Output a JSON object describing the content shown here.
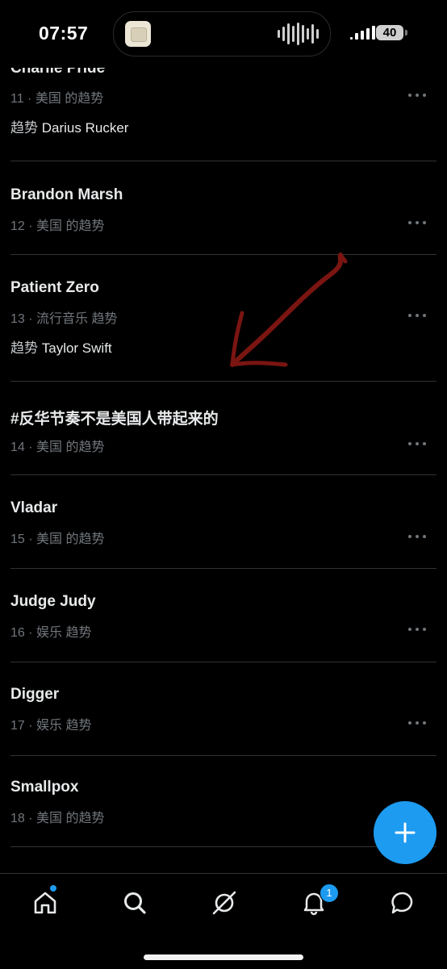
{
  "status_bar": {
    "time": "07:57",
    "battery": "40"
  },
  "trends": [
    {
      "title": "Charlie Pride",
      "meta": "11 · 美国 的趋势",
      "sub_prefix": "趋势 ",
      "sub_name": "Darius Rucker"
    },
    {
      "title": "Brandon Marsh",
      "meta": "12 · 美国 的趋势"
    },
    {
      "title": "Patient Zero",
      "meta": "13 · 流行音乐 趋势",
      "sub_prefix": "趋势 ",
      "sub_name": "Taylor Swift"
    },
    {
      "title": "#反华节奏不是美国人带起来的",
      "meta": "14 · 美国 的趋势"
    },
    {
      "title": "Vladar",
      "meta": "15 · 美国 的趋势"
    },
    {
      "title": "Judge Judy",
      "meta": "16 · 娱乐 趋势"
    },
    {
      "title": "Digger",
      "meta": "17 · 娱乐 趋势"
    },
    {
      "title": "Smallpox",
      "meta": "18 · 美国 的趋势"
    }
  ],
  "annotation": {
    "arrow_color": "#7a1512"
  },
  "nav": {
    "items": [
      "home-icon",
      "search-icon",
      "grok-icon",
      "bell-icon",
      "messages-icon"
    ],
    "notification_count": "1",
    "accent": "#1d9bf0"
  },
  "fab": {
    "icon": "plus-icon"
  }
}
